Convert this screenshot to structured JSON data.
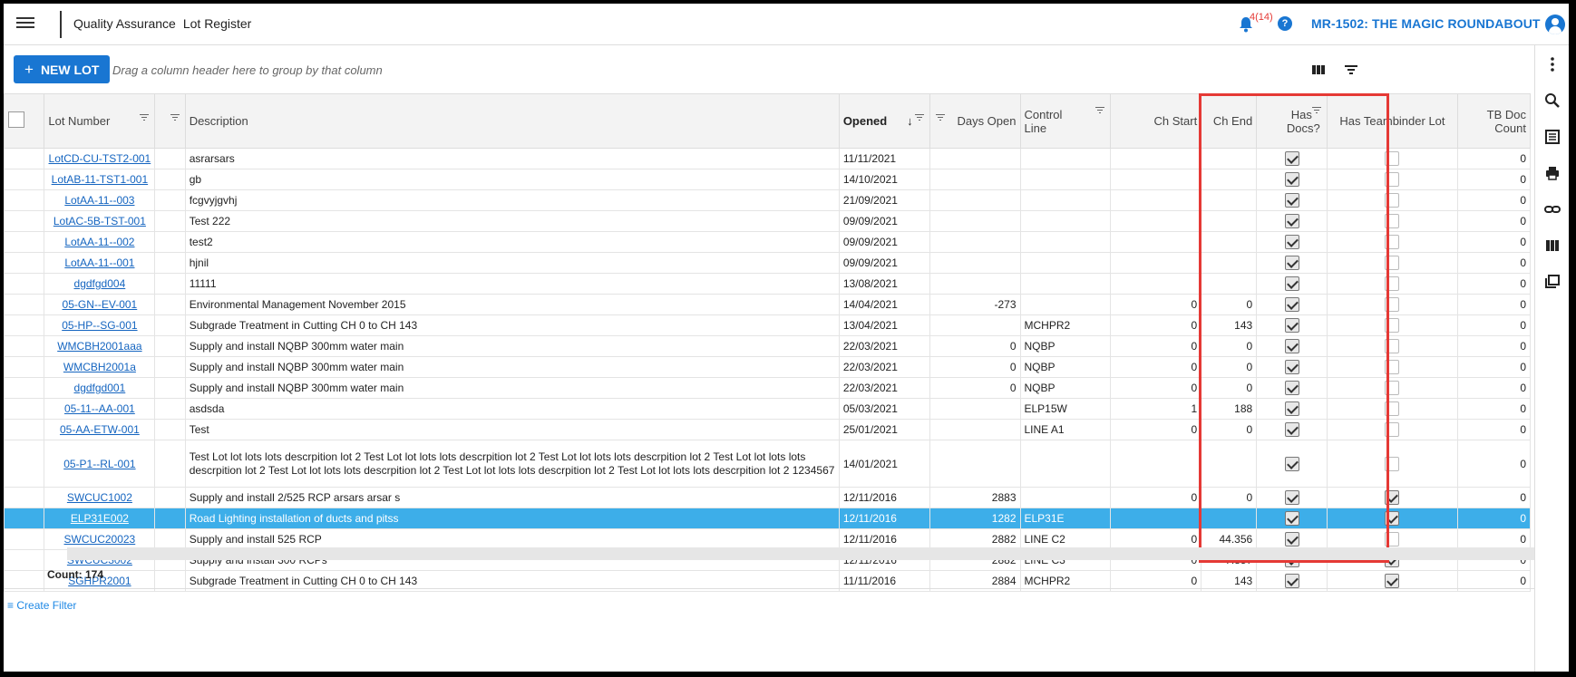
{
  "header": {
    "module": "Quality Assurance",
    "page": "Lot Register",
    "notification_count": "4(14)",
    "help_glyph": "?",
    "project": "MR-1502: THE MAGIC ROUNDABOUT",
    "accent_color": "#1976d2"
  },
  "toolbar": {
    "new_lot_icon": "+",
    "new_lot_label": "NEW LOT",
    "group_hint": "Drag a column header here to group by that column"
  },
  "columns": {
    "lot_number": "Lot Number",
    "description": "Description",
    "opened": "Opened",
    "sort_arrow": "↓",
    "days_open": "Days Open",
    "control_line": "Control Line",
    "ch_start": "Ch Start",
    "ch_end": "Ch End",
    "has_docs": "Has Docs?",
    "has_teambinder": "Has Teambinder Lot",
    "tb_doc_count": "TB Doc Count"
  },
  "rows": [
    {
      "lot": "LotCD-CU-TST2-001",
      "desc": "asrarsars",
      "opened": "11/11/2021",
      "days": "",
      "control": "",
      "chs": "",
      "che": "",
      "docs": true,
      "tb": false,
      "count": "0"
    },
    {
      "lot": "LotAB-11-TST1-001",
      "desc": "gb",
      "opened": "14/10/2021",
      "days": "",
      "control": "",
      "chs": "",
      "che": "",
      "docs": true,
      "tb": false,
      "count": "0"
    },
    {
      "lot": "LotAA-11--003",
      "desc": "fcgvyjgvhj",
      "opened": "21/09/2021",
      "days": "",
      "control": "",
      "chs": "",
      "che": "",
      "docs": true,
      "tb": false,
      "count": "0"
    },
    {
      "lot": "LotAC-5B-TST-001",
      "desc": "Test 222",
      "opened": "09/09/2021",
      "days": "",
      "control": "",
      "chs": "",
      "che": "",
      "docs": true,
      "tb": false,
      "count": "0"
    },
    {
      "lot": "LotAA-11--002",
      "desc": "test2",
      "opened": "09/09/2021",
      "days": "",
      "control": "",
      "chs": "",
      "che": "",
      "docs": true,
      "tb": false,
      "count": "0"
    },
    {
      "lot": "LotAA-11--001",
      "desc": "hjnil",
      "opened": "09/09/2021",
      "days": "",
      "control": "",
      "chs": "",
      "che": "",
      "docs": true,
      "tb": false,
      "count": "0"
    },
    {
      "lot": "dgdfgd004",
      "desc": "11111",
      "opened": "13/08/2021",
      "days": "",
      "control": "",
      "chs": "",
      "che": "",
      "docs": true,
      "tb": false,
      "count": "0"
    },
    {
      "lot": "05-GN--EV-001",
      "desc": "Environmental Management November 2015",
      "opened": "14/04/2021",
      "days": "-273",
      "control": "",
      "chs": "0",
      "che": "0",
      "docs": true,
      "tb": false,
      "count": "0"
    },
    {
      "lot": "05-HP--SG-001",
      "desc": "Subgrade Treatment in Cutting CH 0 to CH 143",
      "opened": "13/04/2021",
      "days": "",
      "control": "MCHPR2",
      "chs": "0",
      "che": "143",
      "docs": true,
      "tb": false,
      "count": "0"
    },
    {
      "lot": "WMCBH2001aaa",
      "desc": "Supply and install NQBP 300mm water main",
      "opened": "22/03/2021",
      "days": "0",
      "control": "NQBP",
      "chs": "0",
      "che": "0",
      "docs": true,
      "tb": false,
      "count": "0"
    },
    {
      "lot": "WMCBH2001a",
      "desc": "Supply and install NQBP 300mm water main",
      "opened": "22/03/2021",
      "days": "0",
      "control": "NQBP",
      "chs": "0",
      "che": "0",
      "docs": true,
      "tb": false,
      "count": "0"
    },
    {
      "lot": "dgdfgd001",
      "desc": "Supply and install NQBP 300mm water main",
      "opened": "22/03/2021",
      "days": "0",
      "control": "NQBP",
      "chs": "0",
      "che": "0",
      "docs": true,
      "tb": false,
      "count": "0"
    },
    {
      "lot": "05-11--AA-001",
      "desc": "asdsda",
      "opened": "05/03/2021",
      "days": "",
      "control": "ELP15W",
      "chs": "1",
      "che": "188",
      "docs": true,
      "tb": false,
      "count": "0"
    },
    {
      "lot": "05-AA-ETW-001",
      "desc": "Test",
      "opened": "25/01/2021",
      "days": "",
      "control": "LINE A1",
      "chs": "0",
      "che": "0",
      "docs": true,
      "tb": false,
      "count": "0"
    },
    {
      "lot": "05-P1--RL-001",
      "desc": "Test Lot lot lots lots descrpition lot 2 Test Lot lot lots lots descrpition lot 2 Test Lot lot lots lots descrpition lot 2 Test Lot lot lots lots descrpition lot 2 Test Lot lot lots lots descrpition lot 2 Test Lot lot lots lots descrpition lot 2 Test Lot lot lots lots descrpition lot 2 1234567",
      "opened": "14/01/2021",
      "days": "",
      "control": "",
      "chs": "",
      "che": "",
      "docs": true,
      "tb": false,
      "count": "0",
      "tall": true
    },
    {
      "lot": "SWCUC1002",
      "desc": "Supply and install 2/525 RCP arsars arsar s",
      "opened": "12/11/2016",
      "days": "2883",
      "control": "",
      "chs": "0",
      "che": "0",
      "docs": true,
      "tb": true,
      "count": "0"
    },
    {
      "lot": "ELP31E002",
      "desc": "Road Lighting installation of ducts and pitss",
      "opened": "12/11/2016",
      "days": "1282",
      "control": "ELP31E",
      "chs": "",
      "che": "",
      "docs": true,
      "tb": true,
      "count": "0",
      "selected": true
    },
    {
      "lot": "SWCUC20023",
      "desc": "Supply and install 525 RCP",
      "opened": "12/11/2016",
      "days": "2882",
      "control": "LINE C2",
      "chs": "0",
      "che": "44.356",
      "docs": true,
      "tb": false,
      "count": "0"
    },
    {
      "lot": "SWCUC3002",
      "desc": "Supply and install 300 RCPs",
      "opened": "12/11/2016",
      "days": "2882",
      "control": "LINE C3",
      "chs": "0",
      "che": "7.857",
      "docs": true,
      "tb": true,
      "count": "0"
    },
    {
      "lot": "SGHPR2001",
      "desc": "Subgrade Treatment in Cutting CH 0 to CH 143",
      "opened": "11/11/2016",
      "days": "2884",
      "control": "MCHPR2",
      "chs": "0",
      "che": "143",
      "docs": true,
      "tb": true,
      "count": "0"
    }
  ],
  "footer": {
    "count_label": "Count: 174",
    "create_filter": "Create Filter"
  },
  "icons": {
    "menu": "hamburger-icon",
    "notifications": "bell-icon",
    "help": "help-icon",
    "user": "account-circle-icon",
    "columns": "column-chooser-icon",
    "filter": "filter-icon",
    "right_bar": [
      "more-vert-icon",
      "search-icon",
      "list-icon",
      "print-icon",
      "link-icon",
      "columns-icon",
      "layers-icon"
    ]
  },
  "colors": {
    "selected_row": "#3daee9",
    "highlight_box": "#e53935",
    "link": "#1565c0"
  }
}
